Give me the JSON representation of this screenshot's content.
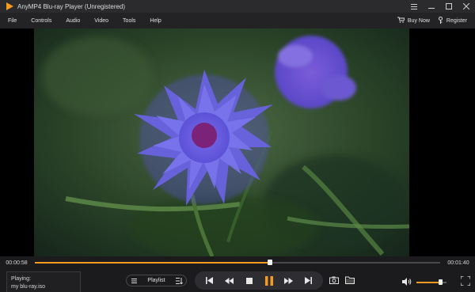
{
  "window": {
    "title": "AnyMP4 Blu-ray Player (Unregistered)",
    "accent_color": "#f39a1f"
  },
  "menu": {
    "items": [
      "File",
      "Controls",
      "Audio",
      "Video",
      "Tools",
      "Help"
    ],
    "buy_now": "Buy Now",
    "register": "Register"
  },
  "player": {
    "current_time": "00:00:58",
    "total_time": "00:01:40",
    "progress": 0.58,
    "volume": 0.8,
    "is_playing": true
  },
  "now_playing": {
    "label": "Playing:",
    "file": "my blu-ray.iso"
  },
  "playlist": {
    "label": "Playlist"
  },
  "icons": {
    "logo": "play-logo-icon",
    "buy": "cart-icon",
    "register": "key-icon",
    "playlist": "list-icon",
    "playlist_sort": "sort-icon",
    "prev": "skip-previous-icon",
    "rewind": "rewind-icon",
    "stop": "stop-icon",
    "pause": "pause-icon",
    "forward": "fast-forward-icon",
    "next": "skip-next-icon",
    "snapshot": "camera-icon",
    "folder": "folder-icon",
    "volume": "speaker-icon",
    "fullscreen": "fullscreen-icon"
  }
}
